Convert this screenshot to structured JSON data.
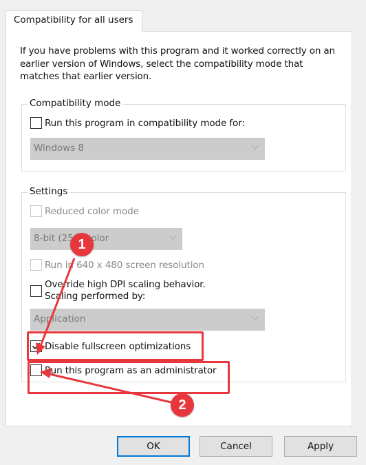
{
  "tab": {
    "label": "Compatibility for all users"
  },
  "intro_text": "If you have problems with this program and it worked correctly on an earlier version of Windows, select the compatibility mode that matches that earlier version.",
  "compat_mode": {
    "title": "Compatibility mode",
    "checkbox_label": "Run this program in compatibility mode for:",
    "checked": false,
    "os_select": {
      "value": "Windows 8",
      "enabled": false
    }
  },
  "settings": {
    "title": "Settings",
    "reduced_color": {
      "label": "Reduced color mode",
      "checked": false,
      "enabled": false
    },
    "color_select": {
      "value": "8-bit (256) color",
      "enabled": false
    },
    "res_640": {
      "label": "Run in 640 x 480 screen resolution",
      "checked": false,
      "enabled": false
    },
    "dpi_override": {
      "label_line1": "Override high DPI scaling behavior.",
      "label_line2": "Scaling performed by:",
      "checked": false
    },
    "dpi_select": {
      "value": "Application",
      "enabled": false
    },
    "disable_fullscreen": {
      "label": "Disable fullscreen optimizations",
      "checked": true
    },
    "run_as_admin": {
      "label": "Run this program as an administrator",
      "checked": false
    }
  },
  "buttons": {
    "ok": "OK",
    "cancel": "Cancel",
    "apply": "Apply"
  },
  "annotations": {
    "color": "#e8373c",
    "badges": [
      "1",
      "2"
    ]
  }
}
